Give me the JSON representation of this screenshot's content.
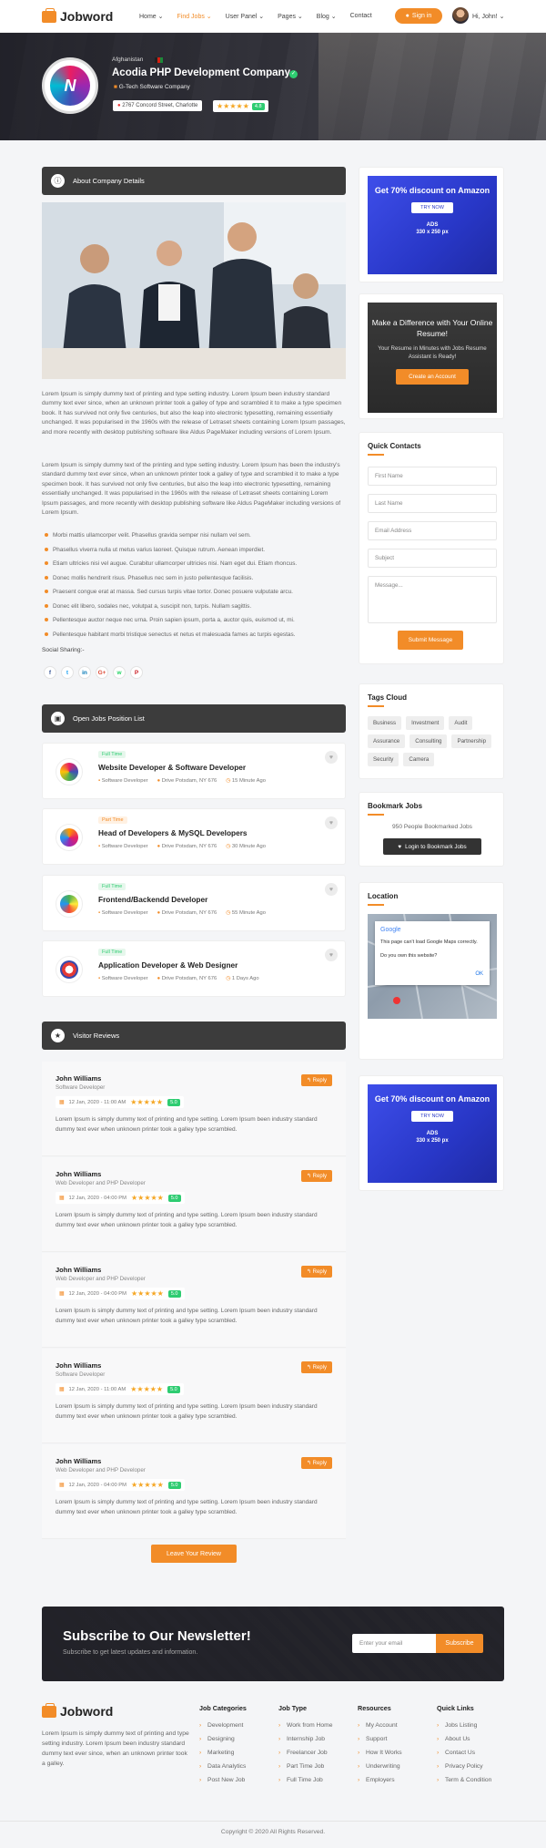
{
  "header": {
    "logo": "Jobword",
    "nav": [
      "Home",
      "Find Jobs",
      "User Panel",
      "Pages",
      "Blog",
      "Contact"
    ],
    "active_nav": "Find Jobs",
    "signin": "Sign in",
    "greeting": "Hi, John!"
  },
  "company": {
    "country": "Afghanistan",
    "name": "Acodia PHP Development Company",
    "category": "G-Tech Software Company",
    "address": "2767 Concord Street, Charlotte",
    "stars": "★★★★★",
    "score": "4.8"
  },
  "about": {
    "heading": "About Company Details",
    "p1": "Lorem Ipsum is simply dummy text of printing and type setting industry. Lorem Ipsum been industry standard dummy text ever since, when an unknown printer took a galley of type and scrambled it to make a type specimen book. It has survived not only five centuries, but also the leap into electronic typesetting, remaining essentially unchanged. It was popularised in the 1960s with the release of Letraset sheets containing Lorem Ipsum passages, and more recently with desktop publishing software like Aldus PageMaker including versions of Lorem Ipsum.",
    "p2": "Lorem Ipsum is simply dummy text of the printing and type setting industry. Lorem Ipsum has been the industry's standard dummy text ever since, when an unknown printer took a galley of type and scrambled it to make a type specimen book. It has survived not only five centuries, but also the leap into electronic typesetting, remaining essentially unchanged. It was popularised in the 1960s with the release of Letraset sheets containing Lorem Ipsum passages, and more recently with desktop publishing software like Aldus PageMaker including versions of Lorem Ipsum.",
    "bullets": [
      "Morbi mattis ullamcorper velit. Phasellus gravida semper nisi nullam vel sem.",
      "Phasellus viverra nulla ut metus varius laoreet. Quisque rutrum. Aenean imperdiet.",
      "Etiam ultricies nisi vel augue. Curabitur ullamcorper ultricies nisi. Nam eget dui. Etiam rhoncus.",
      "Donec mollis hendrerit risus. Phasellus nec sem in justo pellentesque facilisis.",
      "Praesent congue erat at massa. Sed cursus turpis vitae tortor. Donec posuere vulputate arcu.",
      "Donec elit libero, sodales nec, volutpat a, suscipit non, turpis. Nullam sagittis.",
      "Pellentesque auctor neque nec urna. Proin sapien ipsum, porta a, auctor quis, euismod ut, mi.",
      "Pellentesque habitant morbi tristique senectus et netus et malesuada fames ac turpis egestas."
    ],
    "share_label": "Social Sharing:-",
    "share_icons": [
      "f",
      "t",
      "in",
      "G+",
      "w",
      "P"
    ]
  },
  "jobs": {
    "heading": "Open Jobs Position List",
    "items": [
      {
        "tag": "Full Time",
        "title": "Website Developer & Software Developer",
        "category": "Software Developer",
        "location": "Drive Potsdam, NY 676",
        "time": "15 Minute Ago"
      },
      {
        "tag": "Part Time",
        "title": "Head of Developers & MySQL Developers",
        "category": "Software Developer",
        "location": "Drive Potsdam, NY 676",
        "time": "30 Minute Ago"
      },
      {
        "tag": "Full Time",
        "title": "Frontend/Backendd Developer",
        "category": "Software Developer",
        "location": "Drive Potsdam, NY 676",
        "time": "55 Minute Ago"
      },
      {
        "tag": "Full Time",
        "title": "Application Developer & Web Designer",
        "category": "Software Developer",
        "location": "Drive Potsdam, NY 676",
        "time": "1 Days Ago"
      }
    ]
  },
  "reviews": {
    "heading": "Visitor Reviews",
    "reply": "Reply",
    "stars": "★★★★★",
    "items": [
      {
        "name": "John Williams",
        "role": "Software Developer",
        "date": "12 Jan, 2020 - 11:00 AM",
        "score": "5.0",
        "text": "Lorem Ipsum is simply dummy text of printing and type setting. Lorem Ipsum been industry standard dummy text ever when unknown printer took a galley type scrambled."
      },
      {
        "name": "John Williams",
        "role": "Web Developer and PHP Developer",
        "date": "12 Jan, 2020 - 04:00 PM",
        "score": "5.0",
        "text": "Lorem Ipsum is simply dummy text of printing and type setting. Lorem Ipsum been industry standard dummy text ever when unknown printer took a galley type scrambled."
      },
      {
        "name": "John Williams",
        "role": "Web Developer and PHP Developer",
        "date": "12 Jan, 2020 - 04:00 PM",
        "score": "5.0",
        "text": "Lorem Ipsum is simply dummy text of printing and type setting. Lorem Ipsum been industry standard dummy text ever when unknown printer took a galley type scrambled."
      },
      {
        "name": "John Williams",
        "role": "Software Developer",
        "date": "12 Jan, 2020 - 11:00 AM",
        "score": "5.0",
        "text": "Lorem Ipsum is simply dummy text of printing and type setting. Lorem Ipsum been industry standard dummy text ever when unknown printer took a galley type scrambled."
      },
      {
        "name": "John Williams",
        "role": "Web Developer and PHP Developer",
        "date": "12 Jan, 2020 - 04:00 PM",
        "score": "5.0",
        "text": "Lorem Ipsum is simply dummy text of printing and type setting. Lorem Ipsum been industry standard dummy text ever when unknown printer took a galley type scrambled."
      }
    ],
    "leave": "Leave Your Review"
  },
  "sidebar": {
    "ad": {
      "headline": "Get 70% discount on Amazon",
      "button": "TRY NOW",
      "size_label": "ADS",
      "size": "330 x 250 px"
    },
    "promo": {
      "headline": "Make a Difference with Your Online Resume!",
      "text": "Your Resume in Minutes with Jobs Resume Assistant is Ready!",
      "button": "Create an Account"
    },
    "contact": {
      "heading": "Quick Contacts",
      "first": "First Name",
      "last": "Last Name",
      "email": "Email Address",
      "subject": "Subject",
      "message": "Message...",
      "button": "Submit Message"
    },
    "tags": {
      "heading": "Tags Cloud",
      "items": [
        "Business",
        "Investment",
        "Audit",
        "Assurance",
        "Consulting",
        "Partnership",
        "Security",
        "Camera"
      ]
    },
    "bookmark": {
      "heading": "Bookmark Jobs",
      "text": "950 People Bookmarked Jobs",
      "button": "Login to Bookmark Jobs"
    },
    "location": {
      "heading": "Location",
      "brand": "Google",
      "message": "This page can't load Google Maps correctly.",
      "question": "Do you own this website?",
      "ok": "OK"
    }
  },
  "newsletter": {
    "heading": "Subscribe to Our Newsletter!",
    "text": "Subscribe to get latest updates and information.",
    "placeholder": "Enter your email",
    "button": "Subscribe"
  },
  "footer": {
    "logo": "Jobword",
    "text": "Lorem Ipsum is simply dummy text of printing and type setting industry. Lorem Ipsum been industry standard dummy text ever since, when an unknown printer took a galley.",
    "columns": [
      {
        "heading": "Job Categories",
        "links": [
          "Development",
          "Designing",
          "Marketing",
          "Data Analytics",
          "Post New Job"
        ]
      },
      {
        "heading": "Job Type",
        "links": [
          "Work from Home",
          "Internship Job",
          "Freelancer Job",
          "Part Time Job",
          "Full Time Job"
        ]
      },
      {
        "heading": "Resources",
        "links": [
          "My Account",
          "Support",
          "How It Works",
          "Underwriting",
          "Employers"
        ]
      },
      {
        "heading": "Quick Links",
        "links": [
          "Jobs Listing",
          "About Us",
          "Contact Us",
          "Privacy Policy",
          "Term & Condition"
        ]
      }
    ],
    "copyright": "Copyright © 2020 All Rights Reserved."
  },
  "colors": {
    "accent": "#f28c28",
    "dark": "#3c3c3c",
    "green": "#2ecc71",
    "ad_blue": "#2837c7"
  }
}
